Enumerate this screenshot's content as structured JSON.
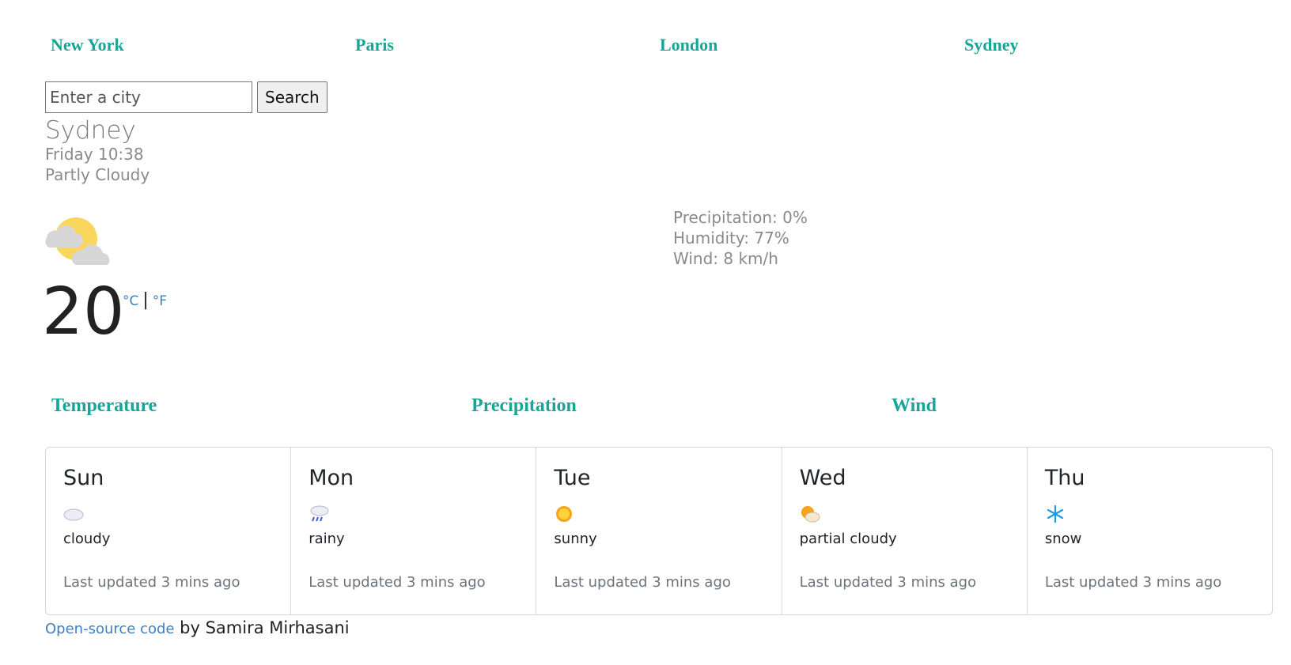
{
  "nav": {
    "cities": [
      "New York",
      "Paris",
      "London",
      "Sydney"
    ]
  },
  "search": {
    "placeholder": "Enter a city",
    "button_label": "Search"
  },
  "current": {
    "city": "Sydney",
    "datetime": "Friday 10:38",
    "condition": "Partly Cloudy",
    "icon": "partly-cloudy-icon",
    "temperature": "20",
    "unit_c": "°C",
    "unit_sep": "|",
    "unit_f": "°F",
    "precipitation": "Precipitation: 0%",
    "humidity": "Humidity: 77%",
    "wind": "Wind: 8 km/h"
  },
  "chart_tabs": [
    "Temperature",
    "Precipitation",
    "Wind"
  ],
  "forecast": [
    {
      "day": "Sun",
      "icon": "cloud-icon",
      "desc": "cloudy",
      "updated": "Last updated 3 mins ago"
    },
    {
      "day": "Mon",
      "icon": "rain-icon",
      "desc": "rainy",
      "updated": "Last updated 3 mins ago"
    },
    {
      "day": "Tue",
      "icon": "sun-icon",
      "desc": "sunny",
      "updated": "Last updated 3 mins ago"
    },
    {
      "day": "Wed",
      "icon": "partly-cloudy-icon",
      "desc": "partial cloudy",
      "updated": "Last updated 3 mins ago"
    },
    {
      "day": "Thu",
      "icon": "snowflake-icon",
      "desc": "snow",
      "updated": "Last updated 3 mins ago"
    }
  ],
  "footer": {
    "link_text": "Open-source code",
    "author_text": " by Samira Mirhasani"
  },
  "colors": {
    "accent": "#16a596",
    "link": "#3d7fc1"
  }
}
